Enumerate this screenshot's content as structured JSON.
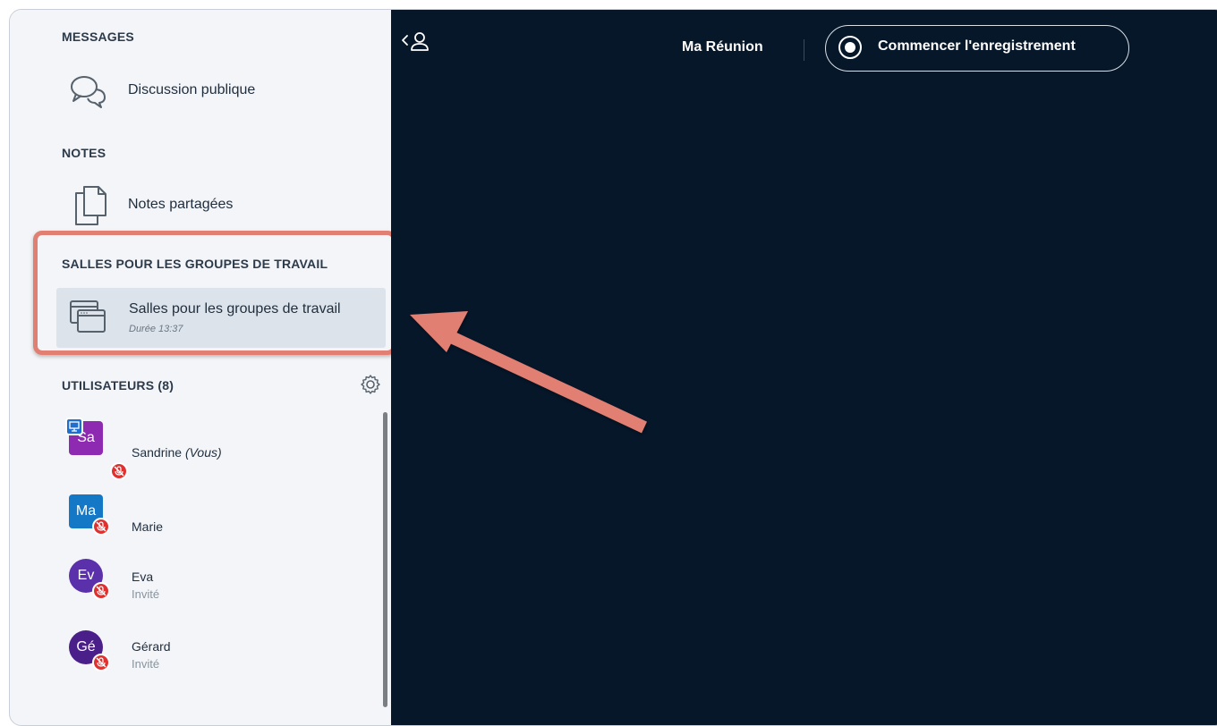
{
  "sidebar": {
    "messages": {
      "title": "MESSAGES",
      "public_chat_label": "Discussion publique",
      "icon": "chat-bubbles-icon"
    },
    "notes": {
      "title": "NOTES",
      "shared_notes_label": "Notes partagées",
      "icon": "document-icon"
    },
    "breakout": {
      "title": "SALLES POUR LES GROUPES DE TRAVAIL",
      "item_label": "Salles pour les groupes de travail",
      "duration": "Durée 13:37",
      "icon": "breakout-rooms-icon"
    },
    "users": {
      "title": "UTILISATEURS (8)",
      "settings_icon": "gear-icon",
      "list": [
        {
          "initials": "Sa",
          "name": "Sandrine",
          "suffix": "(Vous)",
          "role": "",
          "color": "#8e2ab1",
          "shape": "square",
          "presenter": true,
          "muted": true
        },
        {
          "initials": "Ma",
          "name": "Marie",
          "suffix": "",
          "role": "",
          "color": "#1478c7",
          "shape": "square",
          "presenter": false,
          "muted": true
        },
        {
          "initials": "Ev",
          "name": "Eva",
          "suffix": "",
          "role": "Invité",
          "color": "#5b30ab",
          "shape": "round",
          "presenter": false,
          "muted": true
        },
        {
          "initials": "Gé",
          "name": "Gérard",
          "suffix": "",
          "role": "Invité",
          "color": "#4a1f8a",
          "shape": "round",
          "presenter": false,
          "muted": true
        }
      ]
    }
  },
  "topbar": {
    "meeting_title": "Ma Réunion",
    "record_label": "Commencer l'enregistrement",
    "toggle_icon": "user-list-toggle-icon"
  },
  "colors": {
    "main_bg": "#06172a",
    "sidebar_bg": "#f3f5f8",
    "highlight": "#e07f72",
    "mute": "#e03131"
  }
}
